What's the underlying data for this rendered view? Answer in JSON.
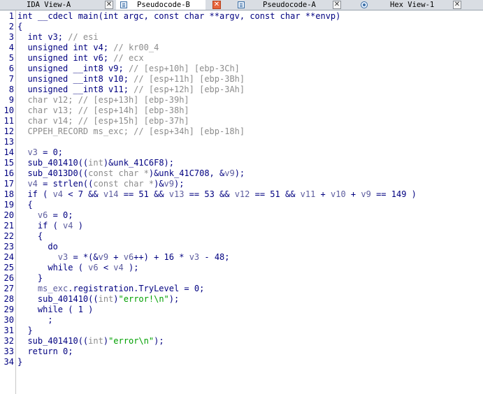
{
  "tabs": [
    {
      "label": "IDA View-A",
      "icon": "doc-icon",
      "active": false
    },
    {
      "label": "Pseudocode-B",
      "icon": "doc-icon",
      "active": true
    },
    {
      "label": "Pseudocode-A",
      "icon": "doc-icon",
      "active": false
    },
    {
      "label": "Hex View-1",
      "icon": "hex-icon",
      "active": false
    }
  ],
  "code_lines": [
    {
      "n": "1",
      "segs": [
        [
          "int __cdecl main(int argc, const char **argv, const char **envp)",
          "k"
        ]
      ]
    },
    {
      "n": "2",
      "segs": [
        [
          "{",
          "k"
        ]
      ]
    },
    {
      "n": "3",
      "segs": [
        [
          "  int v3; ",
          "k"
        ],
        [
          "// esi",
          "c"
        ]
      ]
    },
    {
      "n": "4",
      "segs": [
        [
          "  unsigned int v4; ",
          "k"
        ],
        [
          "// kr00_4",
          "c"
        ]
      ]
    },
    {
      "n": "5",
      "segs": [
        [
          "  unsigned int v6; ",
          "k"
        ],
        [
          "// ecx",
          "c"
        ]
      ]
    },
    {
      "n": "6",
      "segs": [
        [
          "  unsigned __int8 v9; ",
          "k"
        ],
        [
          "// [esp+10h] [ebp-3Ch]",
          "c"
        ]
      ]
    },
    {
      "n": "7",
      "segs": [
        [
          "  unsigned __int8 v10; ",
          "k"
        ],
        [
          "// [esp+11h] [ebp-3Bh]",
          "c"
        ]
      ]
    },
    {
      "n": "8",
      "segs": [
        [
          "  unsigned __int8 v11; ",
          "k"
        ],
        [
          "// [esp+12h] [ebp-3Ah]",
          "c"
        ]
      ]
    },
    {
      "n": "9",
      "segs": [
        [
          "  char v12; // [esp+13h] [ebp-39h]",
          "c"
        ]
      ]
    },
    {
      "n": "10",
      "segs": [
        [
          "  char v13; // [esp+14h] [ebp-38h]",
          "c"
        ]
      ]
    },
    {
      "n": "11",
      "segs": [
        [
          "  char v14; // [esp+15h] [ebp-37h]",
          "c"
        ]
      ]
    },
    {
      "n": "12",
      "segs": [
        [
          "  CPPEH_RECORD ms_exc; // [esp+34h] [ebp-18h]",
          "c"
        ]
      ]
    },
    {
      "n": "13",
      "segs": [
        [
          "",
          "k"
        ]
      ]
    },
    {
      "n": "14",
      "segs": [
        [
          "  ",
          "k"
        ],
        [
          "v3",
          "v"
        ],
        [
          " = 0;",
          "k"
        ]
      ]
    },
    {
      "n": "15",
      "segs": [
        [
          "  sub_401410((",
          "k"
        ],
        [
          "int",
          "c"
        ],
        [
          ")&unk_41C6F8);",
          "k"
        ]
      ]
    },
    {
      "n": "16",
      "segs": [
        [
          "  sub_4013D0((",
          "k"
        ],
        [
          "const char *",
          "c"
        ],
        [
          ")&unk_41C708, &",
          "k"
        ],
        [
          "v9",
          "v"
        ],
        [
          ");",
          "k"
        ]
      ]
    },
    {
      "n": "17",
      "segs": [
        [
          "  ",
          "k"
        ],
        [
          "v4",
          "v"
        ],
        [
          " = strlen((",
          "k"
        ],
        [
          "const char *",
          "c"
        ],
        [
          ")&",
          "k"
        ],
        [
          "v9",
          "v"
        ],
        [
          ");",
          "k"
        ]
      ]
    },
    {
      "n": "18",
      "segs": [
        [
          "  if ( ",
          "k"
        ],
        [
          "v4",
          "v"
        ],
        [
          " < 7 && ",
          "k"
        ],
        [
          "v14",
          "v"
        ],
        [
          " == 51 && ",
          "k"
        ],
        [
          "v13",
          "v"
        ],
        [
          " == 53 && ",
          "k"
        ],
        [
          "v12",
          "v"
        ],
        [
          " == 51 && ",
          "k"
        ],
        [
          "v11",
          "v"
        ],
        [
          " + ",
          "k"
        ],
        [
          "v10",
          "v"
        ],
        [
          " + ",
          "k"
        ],
        [
          "v9",
          "v"
        ],
        [
          " == 149 )",
          "k"
        ]
      ]
    },
    {
      "n": "19",
      "segs": [
        [
          "  {",
          "k"
        ]
      ]
    },
    {
      "n": "20",
      "segs": [
        [
          "    ",
          "k"
        ],
        [
          "v6",
          "v"
        ],
        [
          " = 0;",
          "k"
        ]
      ]
    },
    {
      "n": "21",
      "segs": [
        [
          "    if ( ",
          "k"
        ],
        [
          "v4",
          "v"
        ],
        [
          " )",
          "k"
        ]
      ]
    },
    {
      "n": "22",
      "segs": [
        [
          "    {",
          "k"
        ]
      ]
    },
    {
      "n": "23",
      "segs": [
        [
          "      do",
          "k"
        ]
      ]
    },
    {
      "n": "24",
      "segs": [
        [
          "        ",
          "k"
        ],
        [
          "v3",
          "v"
        ],
        [
          " = *(&",
          "k"
        ],
        [
          "v9",
          "v"
        ],
        [
          " + ",
          "k"
        ],
        [
          "v6",
          "v"
        ],
        [
          "++) + 16 * ",
          "k"
        ],
        [
          "v3",
          "v"
        ],
        [
          " - 48;",
          "k"
        ]
      ]
    },
    {
      "n": "25",
      "segs": [
        [
          "      while ( ",
          "k"
        ],
        [
          "v6",
          "v"
        ],
        [
          " < ",
          "k"
        ],
        [
          "v4",
          "v"
        ],
        [
          " );",
          "k"
        ]
      ]
    },
    {
      "n": "26",
      "segs": [
        [
          "    }",
          "k"
        ]
      ]
    },
    {
      "n": "27",
      "segs": [
        [
          "    ",
          "k"
        ],
        [
          "ms_exc",
          "v"
        ],
        [
          ".registration.TryLevel = 0;",
          "k"
        ]
      ]
    },
    {
      "n": "28",
      "segs": [
        [
          "    sub_401410((",
          "k"
        ],
        [
          "int",
          "c"
        ],
        [
          ")",
          "k"
        ],
        [
          "\"error!\\n\"",
          "s"
        ],
        [
          ");",
          "k"
        ]
      ]
    },
    {
      "n": "29",
      "segs": [
        [
          "    while ( 1 )",
          "k"
        ]
      ]
    },
    {
      "n": "30",
      "segs": [
        [
          "      ;",
          "k"
        ]
      ]
    },
    {
      "n": "31",
      "segs": [
        [
          "  }",
          "k"
        ]
      ]
    },
    {
      "n": "32",
      "segs": [
        [
          "  sub_401410((",
          "k"
        ],
        [
          "int",
          "c"
        ],
        [
          ")",
          "k"
        ],
        [
          "\"error\\n\"",
          "s"
        ],
        [
          ");",
          "k"
        ]
      ]
    },
    {
      "n": "33",
      "segs": [
        [
          "  return 0;",
          "k"
        ]
      ]
    },
    {
      "n": "34",
      "segs": [
        [
          "}",
          "k"
        ]
      ]
    }
  ]
}
